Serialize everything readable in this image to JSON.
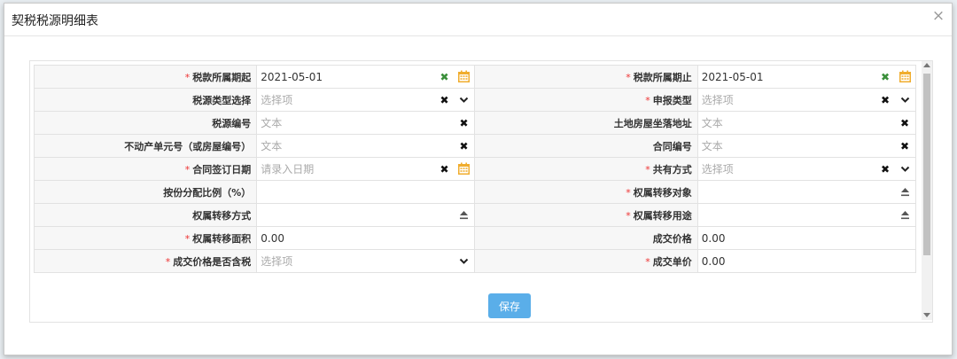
{
  "dialog": {
    "title": "契税税源明细表",
    "close_label": "×"
  },
  "rows": [
    {
      "left": {
        "label": "税款所属期起",
        "required": true,
        "value": "2021-05-01",
        "placeholder": "",
        "icons": [
          "clear-green",
          "calendar"
        ]
      },
      "right": {
        "label": "税款所属期止",
        "required": true,
        "value": "2021-05-01",
        "placeholder": "",
        "icons": [
          "clear-green",
          "calendar"
        ]
      }
    },
    {
      "left": {
        "label": "税源类型选择",
        "required": false,
        "value": "",
        "placeholder": "选择项",
        "icons": [
          "clear",
          "chevron"
        ]
      },
      "right": {
        "label": "申报类型",
        "required": true,
        "value": "",
        "placeholder": "选择项",
        "icons": [
          "clear",
          "chevron"
        ]
      }
    },
    {
      "left": {
        "label": "税源编号",
        "required": false,
        "value": "",
        "placeholder": "文本",
        "icons": [
          "clear"
        ]
      },
      "right": {
        "label": "土地房屋坐落地址",
        "required": false,
        "value": "",
        "placeholder": "文本",
        "icons": [
          "clear"
        ]
      }
    },
    {
      "left": {
        "label": "不动产单元号（或房屋编号）",
        "required": false,
        "value": "",
        "placeholder": "文本",
        "icons": [
          "clear"
        ]
      },
      "right": {
        "label": "合同编号",
        "required": false,
        "value": "",
        "placeholder": "文本",
        "icons": [
          "clear"
        ]
      }
    },
    {
      "left": {
        "label": "合同签订日期",
        "required": true,
        "value": "",
        "placeholder": "请录入日期",
        "icons": [
          "clear",
          "calendar"
        ]
      },
      "right": {
        "label": "共有方式",
        "required": true,
        "value": "",
        "placeholder": "选择项",
        "icons": [
          "clear",
          "chevron"
        ]
      }
    },
    {
      "left": {
        "label": "按份分配比例（%）",
        "required": false,
        "value": "",
        "placeholder": "",
        "icons": []
      },
      "right": {
        "label": "权属转移对象",
        "required": true,
        "value": "",
        "placeholder": "",
        "icons": [
          "upload"
        ]
      }
    },
    {
      "left": {
        "label": "权属转移方式",
        "required": false,
        "value": "",
        "placeholder": "",
        "icons": [
          "upload"
        ]
      },
      "right": {
        "label": "权属转移用途",
        "required": true,
        "value": "",
        "placeholder": "",
        "icons": [
          "upload"
        ]
      }
    },
    {
      "left": {
        "label": "权属转移面积",
        "required": true,
        "value": "0.00",
        "placeholder": "",
        "icons": []
      },
      "right": {
        "label": "成交价格",
        "required": false,
        "value": "0.00",
        "placeholder": "",
        "icons": []
      }
    },
    {
      "left": {
        "label": "成交价格是否含税",
        "required": true,
        "value": "",
        "placeholder": "选择项",
        "icons": [
          "chevron"
        ]
      },
      "right": {
        "label": "成交单价",
        "required": true,
        "value": "0.00",
        "placeholder": "",
        "icons": []
      }
    }
  ],
  "save_label": "保存",
  "colors": {
    "save_button": "#5aaee9",
    "required_mark": "#e33333",
    "calendar": "#f0ad2e",
    "clear_green": "#3a8f3a"
  }
}
